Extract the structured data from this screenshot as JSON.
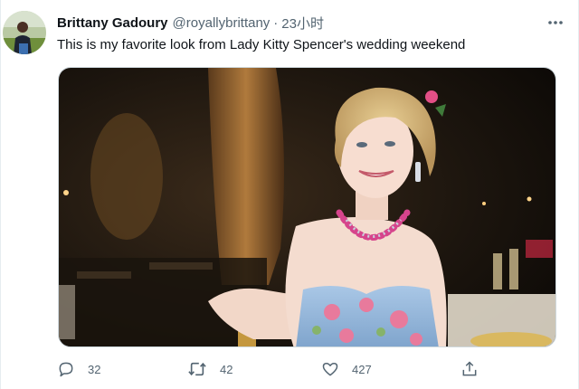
{
  "tweet": {
    "author": {
      "name": "Brittany Gadoury",
      "handle": "@royallybrittany",
      "separator": "·",
      "time": "23小时"
    },
    "text": "This is my favorite look from Lady Kitty Spencer's wedding weekend",
    "actions": {
      "reply_count": "32",
      "retweet_count": "42",
      "like_count": "427"
    }
  },
  "icons": {
    "more": "more-horizontal-icon",
    "reply": "reply-icon",
    "retweet": "retweet-icon",
    "like": "heart-icon",
    "share": "share-icon"
  },
  "colors": {
    "text": "#0f1419",
    "secondary": "#536471",
    "border": "#cfd9de"
  }
}
